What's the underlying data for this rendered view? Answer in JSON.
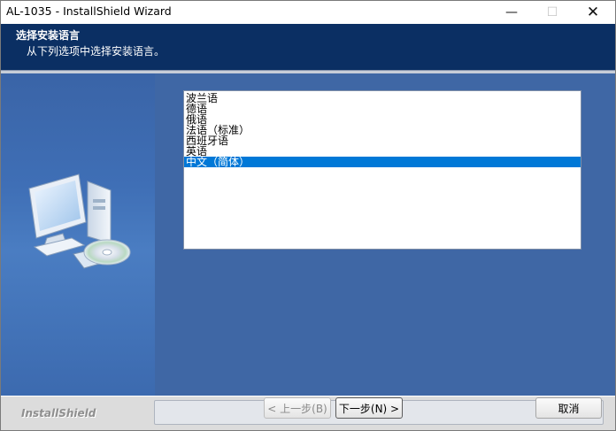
{
  "window": {
    "title": "AL-1035 - InstallShield Wizard",
    "minimize_glyph": "—",
    "maximize_glyph": "☐",
    "close_glyph": "✕"
  },
  "header": {
    "title": "选择安装语言",
    "subtitle": "从下列选项中选择安装语言。"
  },
  "languages": {
    "items": [
      "波兰语",
      "德语",
      "俄语",
      "法语（标准）",
      "西班牙语",
      "英语",
      "中文（简体）"
    ],
    "selected": "中文（简体）"
  },
  "footer": {
    "brand": "InstallShield",
    "back_label": "< 上一步(B)",
    "next_label": "下一步(N) >",
    "cancel_label": "取消"
  },
  "colors": {
    "header_bg": "#0b2f63",
    "content_bg": "#3f67a5",
    "selection": "#0078d7"
  },
  "icons": {
    "computer": "computer-with-cd-icon"
  }
}
